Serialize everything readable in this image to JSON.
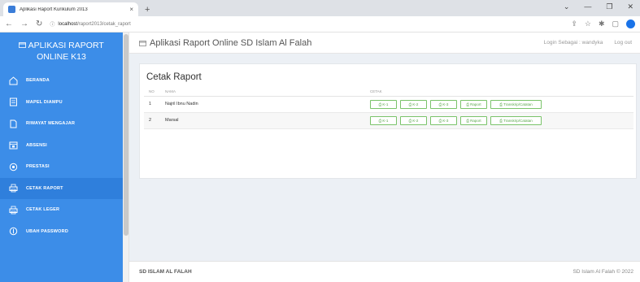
{
  "browser": {
    "tab_title": "Aplikasi Raport Kurikulum 2013",
    "tab_close": "×",
    "new_tab": "+",
    "url_host": "localhost",
    "url_path": "/raport2013/cetak_raport",
    "win_min": "—",
    "win_restore": "❐",
    "win_close": "✕"
  },
  "sidebar": {
    "brand_line1": "APLIKASI RAPORT",
    "brand_line2": "ONLINE K13",
    "items": [
      {
        "label": "BERANDA",
        "icon": "home-icon"
      },
      {
        "label": "MAPEL DIAMPU",
        "icon": "book-icon"
      },
      {
        "label": "RIWAYAT MENGAJAR",
        "icon": "document-icon"
      },
      {
        "label": "ABSENSI",
        "icon": "calendar-icon"
      },
      {
        "label": "PRESTASI",
        "icon": "award-icon"
      },
      {
        "label": "CETAK RAPORT",
        "icon": "printer-icon"
      },
      {
        "label": "CETAK LEGER",
        "icon": "printer-icon"
      },
      {
        "label": "UBAH PASSWORD",
        "icon": "key-icon"
      }
    ]
  },
  "topbar": {
    "title": "Aplikasi Raport Online SD Islam Al Falah",
    "login_as": "Login Sebagai : ",
    "user": "wandyka",
    "logout": "Log out"
  },
  "content": {
    "heading": "Cetak Raport",
    "columns": [
      "NO",
      "NAMA",
      "CETAK"
    ],
    "rows": [
      {
        "no": "1",
        "nama": "Najril Ibnu Nadin",
        "b1": "K-1",
        "b2": "K-2",
        "b3": "K-3",
        "b4": "Raport",
        "b5": "Transkrip/Catatan"
      },
      {
        "no": "2",
        "nama": "Marsal",
        "b1": "K-1",
        "b2": "K-2",
        "b3": "K-3",
        "b4": "Raport",
        "b5": "Transkrip/Catatan"
      }
    ]
  },
  "footer": {
    "left": "SD ISLAM AL FALAH",
    "right": "SD Islam Al Falah © 2022"
  },
  "colors": {
    "sidebar": "#3c8de8",
    "button_border": "#7ac36a",
    "background": "#ecf0f5"
  }
}
